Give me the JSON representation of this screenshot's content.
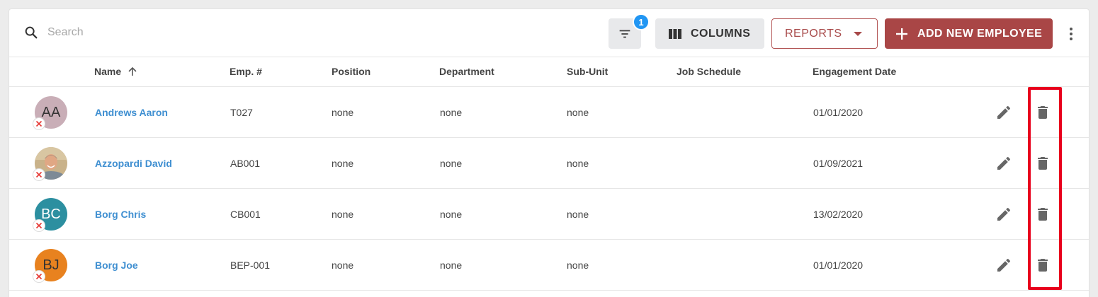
{
  "search": {
    "placeholder": "Search",
    "value": ""
  },
  "toolbar": {
    "filter_badge_count": "1",
    "columns_label": "COLUMNS",
    "reports_label": "REPORTS",
    "add_label": "ADD NEW EMPLOYEE"
  },
  "table": {
    "headers": {
      "name": "Name",
      "emp_no": "Emp. #",
      "position": "Position",
      "department": "Department",
      "subunit": "Sub-Unit",
      "job_schedule": "Job Schedule",
      "engagement_date": "Engagement Date"
    },
    "rows": [
      {
        "initials": "AA",
        "avatar_color": "#c9aeb7",
        "avatar_text_color": "#333333",
        "name": "Andrews Aaron",
        "emp_no": "T027",
        "position": "none",
        "department": "none",
        "subunit": "none",
        "job_schedule": "",
        "engagement_date": "01/01/2020"
      },
      {
        "initials": "",
        "avatar_photo": true,
        "name": "Azzopardi David",
        "emp_no": "AB001",
        "position": "none",
        "department": "none",
        "subunit": "none",
        "job_schedule": "",
        "engagement_date": "01/09/2021"
      },
      {
        "initials": "BC",
        "avatar_color": "#2c8fa0",
        "avatar_text_color": "#ffffff",
        "name": "Borg Chris",
        "emp_no": "CB001",
        "position": "none",
        "department": "none",
        "subunit": "none",
        "job_schedule": "",
        "engagement_date": "13/02/2020"
      },
      {
        "initials": "BJ",
        "avatar_color": "#e8821f",
        "avatar_text_color": "#333333",
        "name": "Borg Joe",
        "emp_no": "BEP-001",
        "position": "none",
        "department": "none",
        "subunit": "none",
        "job_schedule": "",
        "engagement_date": "01/01/2020"
      }
    ]
  },
  "colors": {
    "accent_red": "#a94646",
    "link_blue": "#3f8fd1",
    "badge_blue": "#2196f3",
    "highlight_red": "#e8001c"
  },
  "icons": {
    "search": "search-icon",
    "filter": "filter-icon",
    "columns": "columns-icon",
    "add": "plus-icon",
    "more": "more-vert-icon",
    "sort": "arrow-up-icon",
    "edit": "pencil-icon",
    "delete": "trash-icon",
    "status": "close-icon"
  }
}
